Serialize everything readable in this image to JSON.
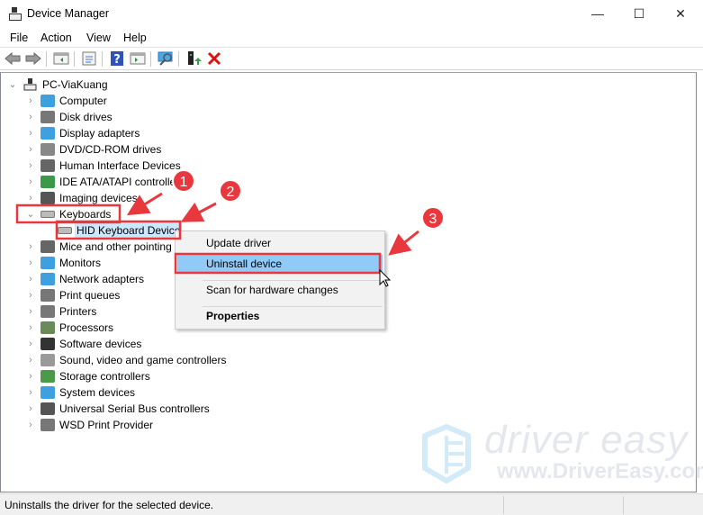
{
  "window": {
    "title": "Device Manager",
    "minimize": "—",
    "maximize": "☐",
    "close": "✕"
  },
  "menubar": [
    "File",
    "Action",
    "View",
    "Help"
  ],
  "toolbar": [
    "back-icon",
    "forward-icon",
    "show-hide-console-tree-icon",
    "properties-icon",
    "help-icon",
    "action-pane-icon",
    "scan-hardware-icon",
    "update-driver-icon",
    "uninstall-icon"
  ],
  "tree": {
    "root": "PC-ViaKuang",
    "items": [
      "Computer",
      "Disk drives",
      "Display adapters",
      "DVD/CD-ROM drives",
      "Human Interface Devices",
      "IDE ATA/ATAPI controllers",
      "Imaging devices",
      "Keyboards",
      "HID Keyboard Device",
      "Mice and other pointing devices",
      "Monitors",
      "Network adapters",
      "Print queues",
      "Printers",
      "Processors",
      "Software devices",
      "Sound, video and game controllers",
      "Storage controllers",
      "System devices",
      "Universal Serial Bus controllers",
      "WSD Print Provider"
    ]
  },
  "context_menu": {
    "update": "Update driver",
    "uninstall": "Uninstall device",
    "scan": "Scan for hardware changes",
    "properties": "Properties"
  },
  "status": "Uninstalls the driver for the selected device.",
  "annotations": {
    "step1": "1",
    "step2": "2",
    "step3": "3",
    "color": "#e8383d"
  },
  "watermark": {
    "brand": "driver easy",
    "url": "www.DriverEasy.com"
  },
  "colors": {
    "selection": "#cce8ff",
    "menu_highlight": "#91c9f7"
  }
}
